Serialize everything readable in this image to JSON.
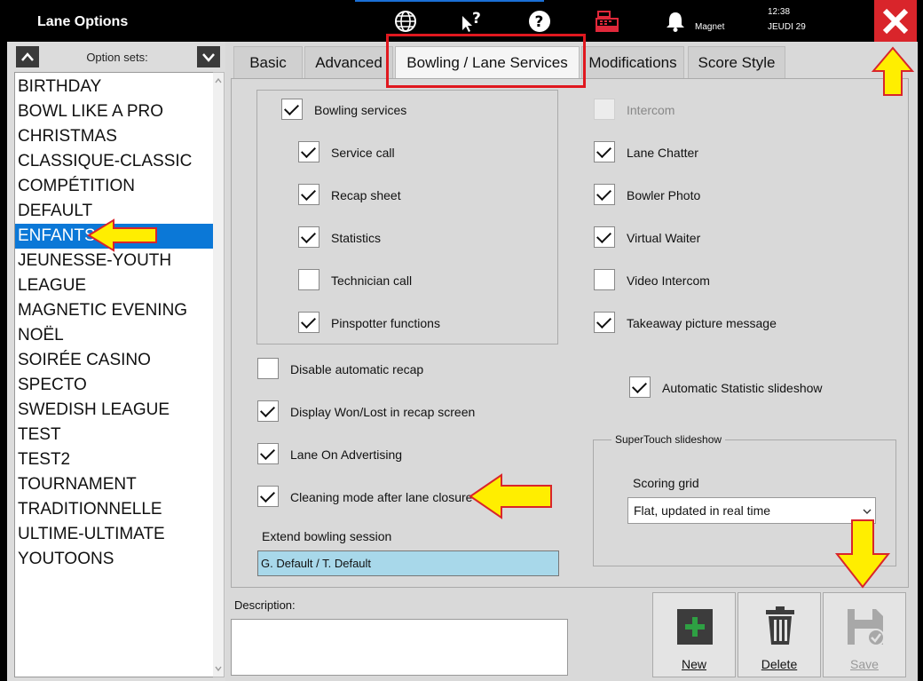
{
  "window": {
    "title": "Lane Options",
    "magnet_label": "Magnet",
    "time": "12:38",
    "date": "JEUDI 29"
  },
  "icons": [
    "globe-icon",
    "help-pointer-icon",
    "question-icon",
    "cash-register-icon",
    "bell-icon",
    "close-icon"
  ],
  "option_sets": {
    "label": "Option sets:",
    "items": [
      "BIRTHDAY",
      "BOWL LIKE A PRO",
      "CHRISTMAS",
      "CLASSIQUE-CLASSIC",
      "COMPÉTITION",
      "DEFAULT",
      "ENFANTS",
      "JEUNESSE-YOUTH",
      "LEAGUE",
      "MAGNETIC EVENING",
      "NOËL",
      "SOIRÉE CASINO",
      "SPECTO",
      "SWEDISH LEAGUE",
      "TEST",
      "TEST2",
      "TOURNAMENT",
      "TRADITIONNELLE",
      "ULTIME-ULTIMATE",
      "YOUTOONS"
    ],
    "selected": "ENFANTS"
  },
  "tabs": [
    "Basic",
    "Advanced",
    "Bowling / Lane Services",
    "Modifications",
    "Score Style"
  ],
  "active_tab": "Bowling / Lane Services",
  "bowling_services": {
    "main": {
      "label": "Bowling services",
      "checked": true
    },
    "items": [
      {
        "label": "Service call",
        "checked": true
      },
      {
        "label": "Recap sheet",
        "checked": true
      },
      {
        "label": "Statistics",
        "checked": true
      },
      {
        "label": "Technician call",
        "checked": false
      },
      {
        "label": "Pinspotter functions",
        "checked": true
      }
    ]
  },
  "right_options": [
    {
      "label": "Intercom",
      "checked": false,
      "disabled": true
    },
    {
      "label": "Lane Chatter",
      "checked": true
    },
    {
      "label": "Bowler Photo",
      "checked": true
    },
    {
      "label": "Virtual Waiter",
      "checked": true
    },
    {
      "label": "Video Intercom",
      "checked": false
    },
    {
      "label": "Takeaway picture message",
      "checked": true
    }
  ],
  "left_options": [
    {
      "label": "Disable automatic recap",
      "checked": false
    },
    {
      "label": "Display Won/Lost in recap screen",
      "checked": true
    },
    {
      "label": "Lane On Advertising",
      "checked": true
    },
    {
      "label": "Cleaning mode after lane closure",
      "checked": true
    }
  ],
  "auto_stat": {
    "label": "Automatic Statistic slideshow",
    "checked": true
  },
  "supertouch": {
    "title": "SuperTouch slideshow",
    "grid_label": "Scoring grid",
    "grid_value": "Flat, updated in real time"
  },
  "extend": {
    "label": "Extend bowling session",
    "value": "G. Default / T. Default"
  },
  "description": {
    "label": "Description:",
    "value": ""
  },
  "actions": [
    {
      "label": "New",
      "enabled": true
    },
    {
      "label": "Delete",
      "enabled": true
    },
    {
      "label": "Save",
      "enabled": false
    }
  ],
  "colors": {
    "selection": "#0b78d7",
    "close": "#d9252b",
    "highlight": "#e0181f",
    "annotation_arrow": "#ffee00",
    "new_icon": "#2ea043",
    "extend_field": "#a8d8ea"
  }
}
